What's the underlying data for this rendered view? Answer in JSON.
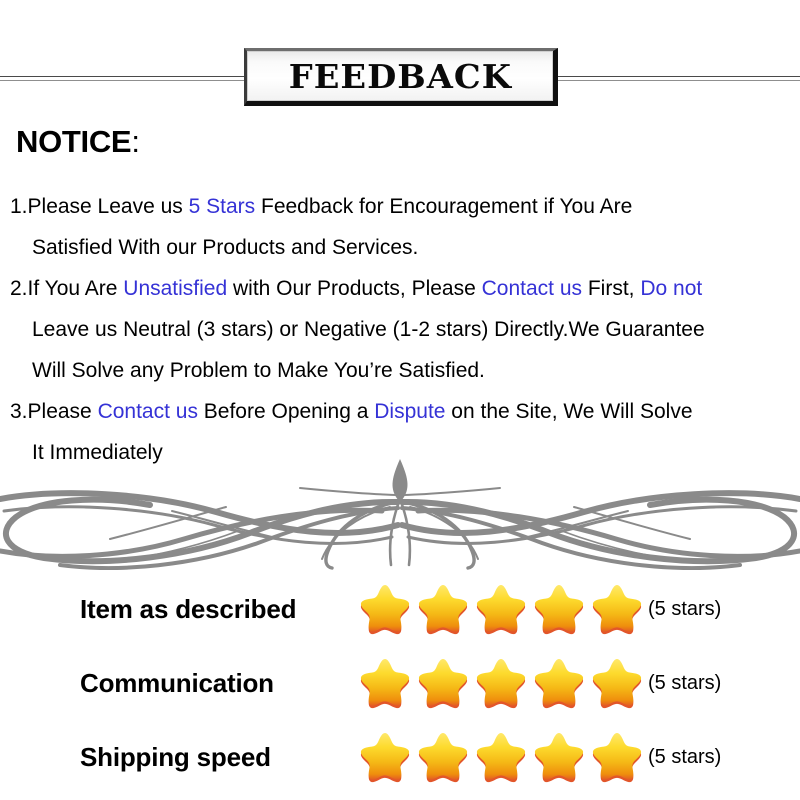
{
  "header": {
    "banner_title": "FEEDBACK"
  },
  "notice": {
    "heading": "NOTICE",
    "heading_colon": ":",
    "items": [
      {
        "number": "1.",
        "line1_parts": [
          {
            "text": "Please Leave us ",
            "highlight": false
          },
          {
            "text": " 5 Stars ",
            "highlight": true
          },
          {
            "text": " Feedback for  Encouragement  if You Are",
            "highlight": false
          }
        ],
        "line2_parts": [
          {
            "text": "Satisfied With our Products and Services.",
            "highlight": false
          }
        ]
      },
      {
        "number": "2.",
        "line1_parts": [
          {
            "text": "If You Are ",
            "highlight": false
          },
          {
            "text": "Unsatisfied",
            "highlight": true
          },
          {
            "text": " with Our Products, Please ",
            "highlight": false
          },
          {
            "text": "Contact us",
            "highlight": true
          },
          {
            "text": " First, ",
            "highlight": false
          },
          {
            "text": "Do not",
            "highlight": true
          }
        ],
        "line2_parts": [
          {
            "text": "Leave us Neutral (3 stars) or Negative (1-2 stars) Directly.We Guarantee",
            "highlight": false
          }
        ],
        "line3_parts": [
          {
            "text": "Will Solve any Problem to Make You’re  Satisfied.",
            "highlight": false
          }
        ]
      },
      {
        "number": "3.",
        "line1_parts": [
          {
            "text": "Please ",
            "highlight": false
          },
          {
            "text": "Contact us",
            "highlight": true
          },
          {
            "text": " Before Opening a ",
            "highlight": false
          },
          {
            "text": "Dispute",
            "highlight": true
          },
          {
            "text": " on the Site, We Will Solve",
            "highlight": false
          }
        ],
        "line2_parts": [
          {
            "text": "It Immediately",
            "highlight": false
          }
        ]
      }
    ]
  },
  "ratings": {
    "rows": [
      {
        "label": "Item as described",
        "star_count": 5,
        "note": "(5 stars)"
      },
      {
        "label": "Communication",
        "star_count": 5,
        "note": "(5 stars)"
      },
      {
        "label": "Shipping speed",
        "star_count": 5,
        "note": "(5 stars)"
      }
    ]
  },
  "colors": {
    "highlight_blue": "#3532d6",
    "ornament_gray": "#8a8a8a",
    "star_top": "#ffe14d",
    "star_mid": "#f5c518",
    "star_bottom": "#e88b0c",
    "star_edge": "#e2562a"
  }
}
